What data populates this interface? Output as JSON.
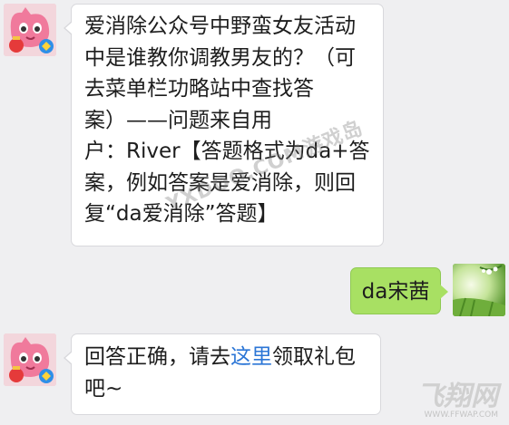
{
  "messages": [
    {
      "sender": "official",
      "lines": [
        "爱消除公众号中野蛮女友活动",
        "中是谁教你调教男友的？（可",
        "去菜单栏功略站中查找答",
        "案）——问题来自用",
        "户：River【答题格式为da+答",
        "案，例如答案是爱消除，则回",
        "复“da爱消除”答题】"
      ]
    },
    {
      "sender": "user",
      "text": "da宋茜"
    },
    {
      "sender": "official",
      "line1_before": "回答正确，请去",
      "line1_link": "这里",
      "line1_after": "领取礼包",
      "line2": "吧~"
    }
  ],
  "watermark": "YXDOO.COM游戏岛",
  "logo": {
    "main": "飞翔网",
    "sub": "WWW.FFWAP.COM"
  },
  "colors": {
    "background": "#efeff1",
    "user_bubble": "#a8e063",
    "link": "#2c76d6"
  }
}
